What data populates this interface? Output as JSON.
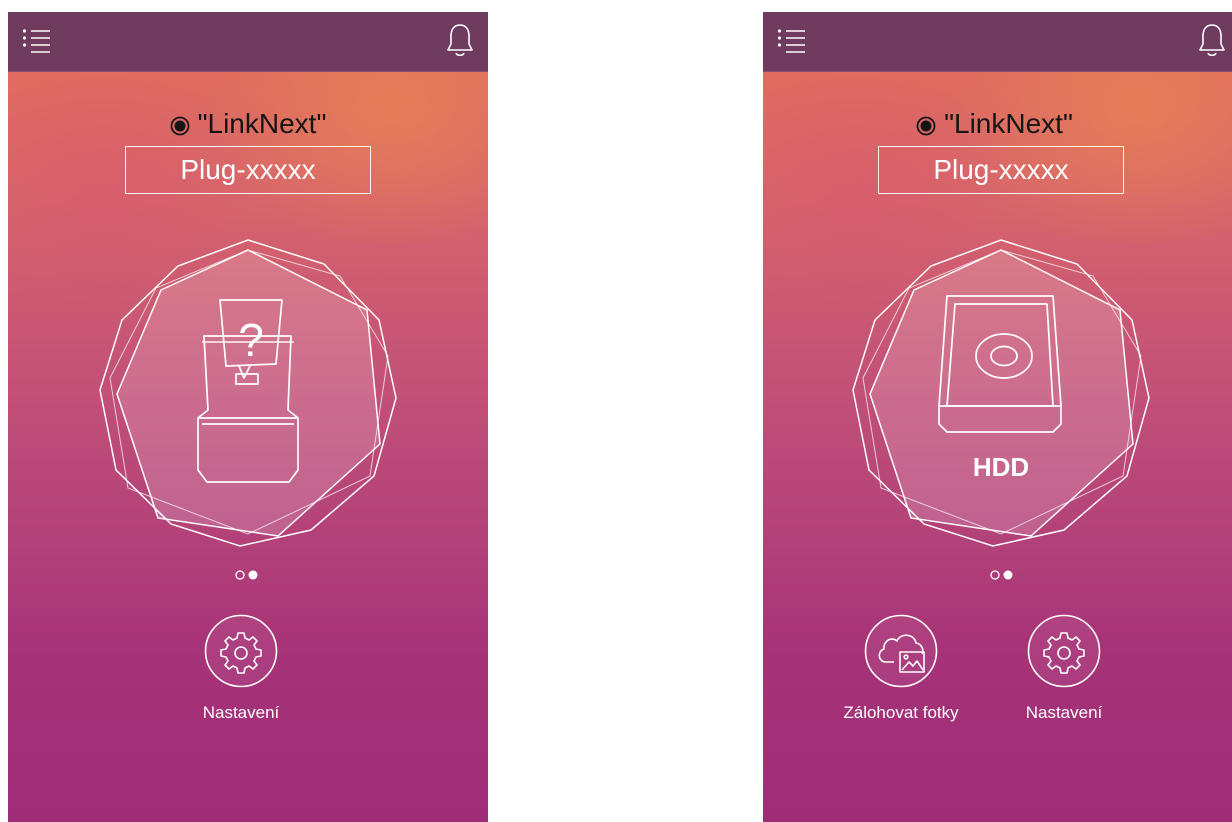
{
  "screens": [
    {
      "wifi_name": "\"LinkNext\"",
      "device_name": "Plug-xxxxx",
      "device_icon": "unknown-device-icon",
      "page_indicator": {
        "count": 2,
        "active": 2
      },
      "actions": [
        {
          "label": "Nastavení",
          "icon": "gear-icon"
        }
      ]
    },
    {
      "wifi_name": "\"LinkNext\"",
      "device_name": "Plug-xxxxx",
      "device_icon": "hdd-icon",
      "device_label": "HDD",
      "page_indicator": {
        "count": 2,
        "active": 2
      },
      "actions": [
        {
          "label": "Zálohovat fotky",
          "icon": "cloud-photo-icon"
        },
        {
          "label": "Nastavení",
          "icon": "gear-icon"
        }
      ]
    }
  ],
  "colors": {
    "topbar": "#6f3b5f",
    "gradient_top": "#e2705a",
    "gradient_bottom": "#9f2c77",
    "line": "#ffffff"
  }
}
